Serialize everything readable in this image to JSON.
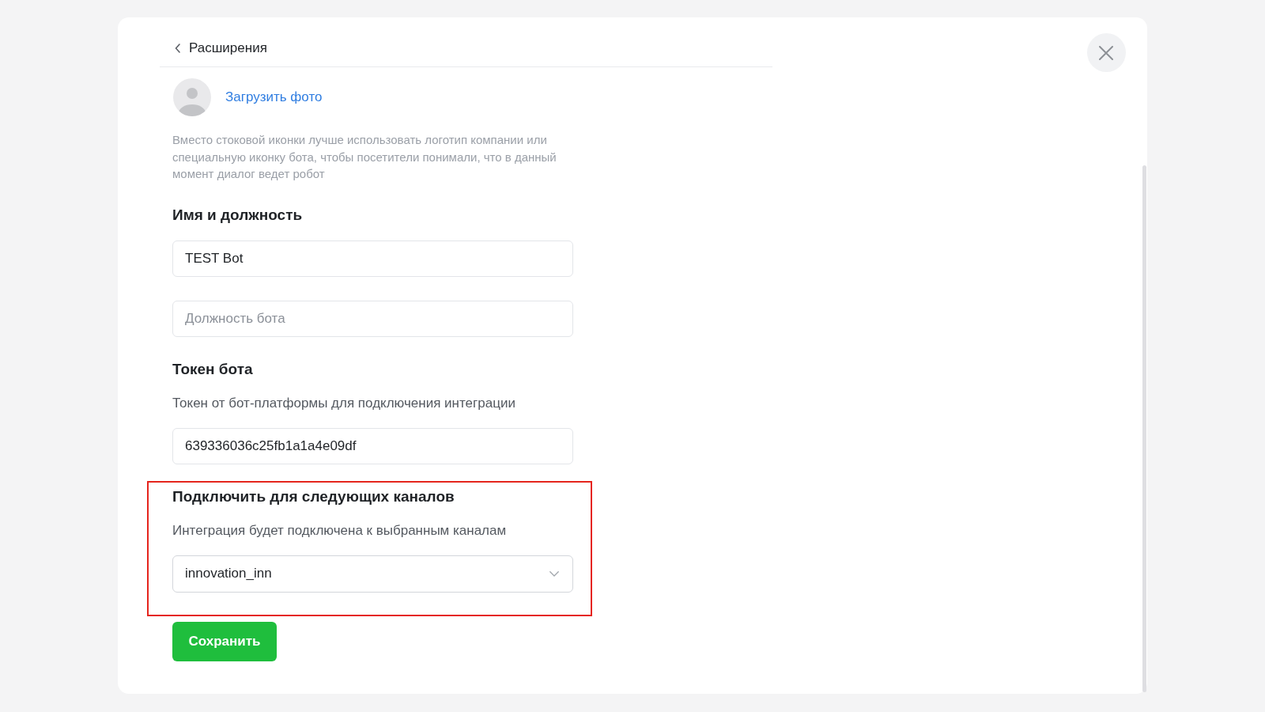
{
  "back_link": {
    "label": "Расширения"
  },
  "avatar": {
    "upload_link": "Загрузить фото",
    "hint": "Вместо стоковой иконки лучше использовать логотип компании или специальную иконку бота, чтобы посетители понимали, что в данный момент диалог ведет робот"
  },
  "sections": [
    {
      "title": "Имя и должность",
      "highlighted": false,
      "fields": [
        {
          "kind": "text",
          "value": "TEST Bot"
        },
        {
          "kind": "text",
          "placeholder": "Должность бота"
        }
      ]
    },
    {
      "title": "Токен бота",
      "description": "Токен от бот-платформы для подключения интеграции",
      "highlighted": false,
      "fields": [
        {
          "kind": "text",
          "value": "639336036c25fb1a1a4e09df"
        }
      ]
    },
    {
      "title": "Подключить для следующих каналов",
      "description": "Интеграция будет подключена к выбранным каналам",
      "highlighted": true,
      "fields": [
        {
          "kind": "select",
          "value": "innovation_inn"
        }
      ]
    }
  ],
  "save_button": {
    "label": "Сохранить"
  }
}
